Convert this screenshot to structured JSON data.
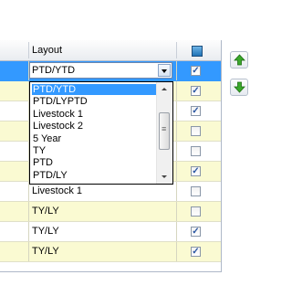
{
  "grid": {
    "header": {
      "layout_label": "Layout",
      "all_checked": true
    },
    "rows": [
      {
        "layout": "",
        "checked": true,
        "selected": true
      },
      {
        "layout": "",
        "checked": true
      },
      {
        "layout": "",
        "checked": true
      },
      {
        "layout": "",
        "checked": false
      },
      {
        "layout": "",
        "checked": false
      },
      {
        "layout": "",
        "checked": true
      },
      {
        "layout": "Livestock 1",
        "checked": false
      },
      {
        "layout": "TY/LY",
        "checked": false
      },
      {
        "layout": "TY/LY",
        "checked": true
      },
      {
        "layout": "TY/LY",
        "checked": true
      }
    ]
  },
  "combo": {
    "value": "PTD/YTD",
    "options": [
      "PTD/YTD",
      "PTD/LYPTD",
      "Livestock 1",
      "Livestock 2",
      "5 Year",
      "TY",
      "PTD",
      "PTD/LY"
    ],
    "highlighted_index": 0
  },
  "side_buttons": {
    "move_up_icon": "green-up-arrow-icon",
    "move_down_icon": "green-down-arrow-icon"
  },
  "colors": {
    "selection": "#3399ff",
    "row_alt": "#fafad2",
    "arrow_green": "#3aa82a"
  }
}
